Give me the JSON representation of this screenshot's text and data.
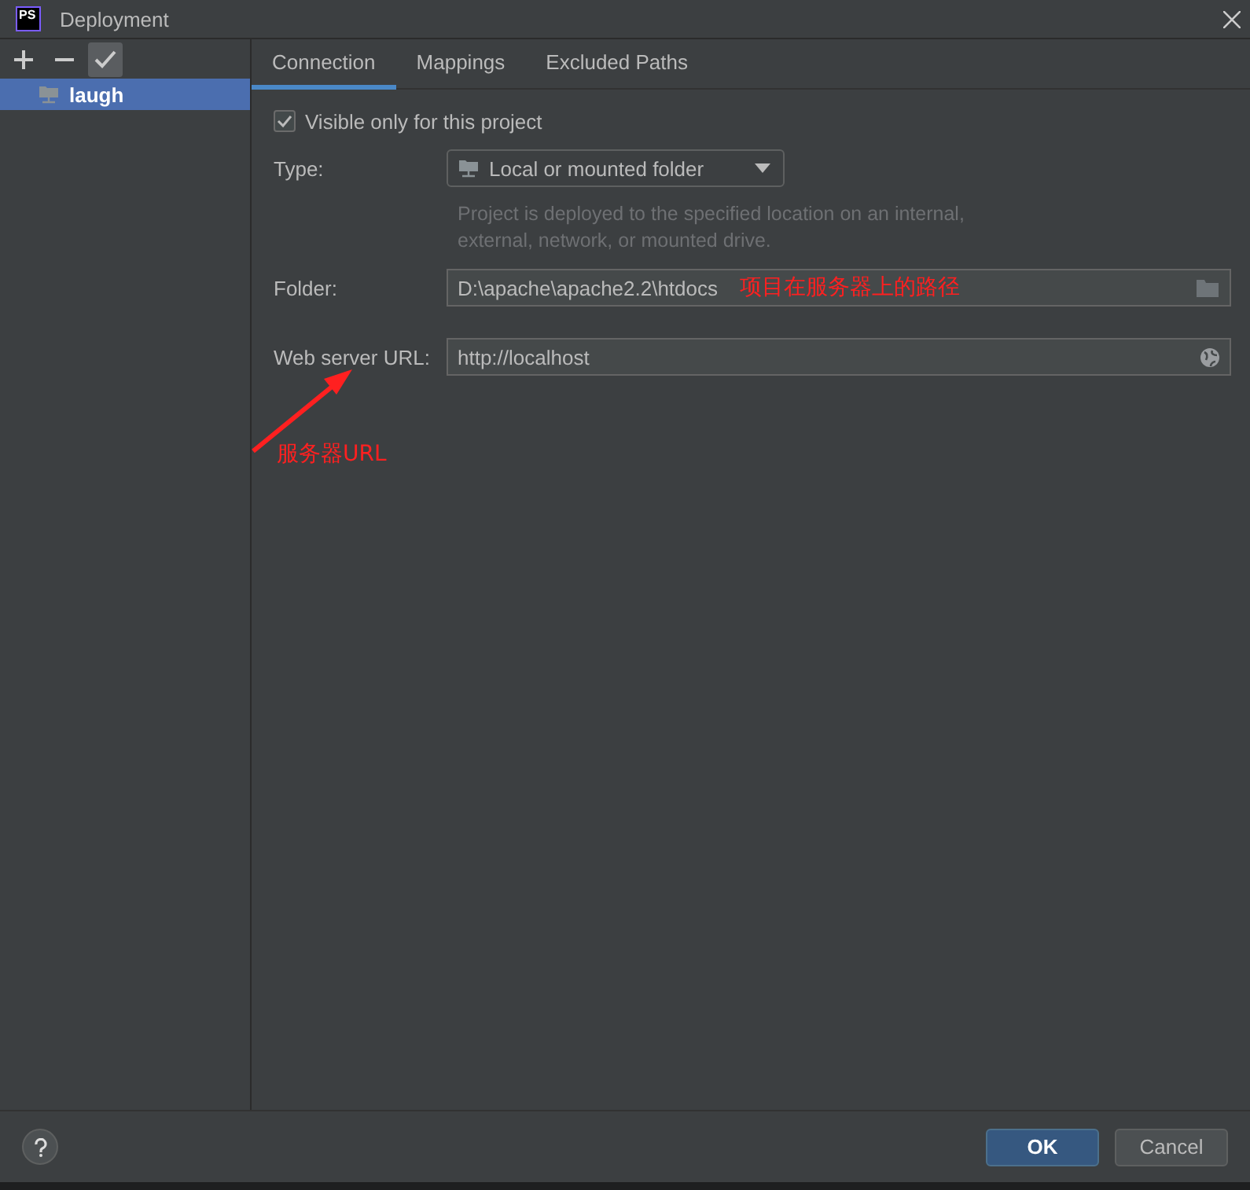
{
  "window": {
    "title": "Deployment",
    "logo": "PS"
  },
  "sidebar": {
    "toolbar": [
      {
        "kind": "add",
        "on": false
      },
      {
        "kind": "remove",
        "on": false
      },
      {
        "kind": "check",
        "on": true
      }
    ],
    "items": [
      {
        "label": "laugh",
        "selected": true
      }
    ]
  },
  "tabs": [
    {
      "label": "Connection",
      "selected": true
    },
    {
      "label": "Mappings",
      "selected": false
    },
    {
      "label": "Excluded Paths",
      "selected": false
    }
  ],
  "visible_only": {
    "label": "Visible only for this project",
    "checked": true
  },
  "type": {
    "label": "Type:",
    "value": "Local or mounted folder",
    "hint": "Project is deployed to the specified location on an internal, external, network, or mounted drive."
  },
  "folder": {
    "label": "Folder:",
    "value": "D:\\apache\\apache2.2\\htdocs"
  },
  "web_server_url": {
    "label": "Web server URL:",
    "value": "http://localhost"
  },
  "annotations": [
    {
      "kind": "note_on_folder",
      "text": "项目在服务器上的路径"
    },
    {
      "kind": "arrow_note",
      "text": "服务器URL"
    }
  ],
  "buttons": [
    {
      "label": "OK",
      "default": true
    },
    {
      "label": "Cancel",
      "default": false
    }
  ]
}
